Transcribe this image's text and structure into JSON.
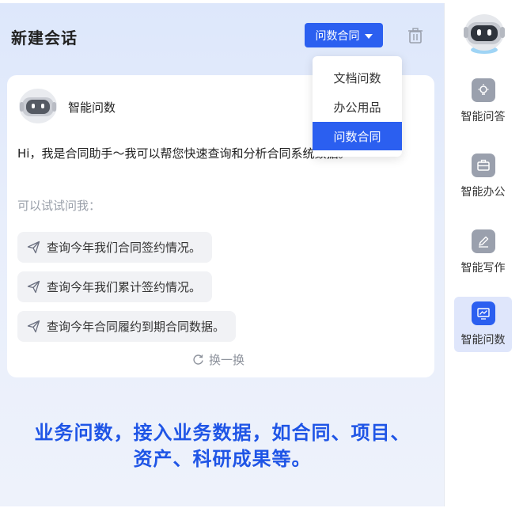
{
  "header": {
    "title": "新建会话",
    "mode_select": "问数合同",
    "trash_icon": "trash-icon"
  },
  "dropdown": {
    "items": [
      "文档问数",
      "办公用品",
      "问数合同"
    ],
    "active_index": 2
  },
  "card": {
    "bot_name": "智能问数",
    "intro": "Hi，我是合同助手～我可以帮您快速查询和分析合同系统数据。",
    "try_label": "可以试试问我：",
    "suggestions": [
      "查询今年我们合同签约情况。",
      "查询今年我们累计签约情况。",
      "查询今年合同履约到期合同数据。"
    ],
    "refresh_label": "换一换"
  },
  "banner": {
    "line1": "业务问数，接入业务数据，如合同、项目、",
    "line2": "资产、科研成果等。"
  },
  "sidebar": {
    "items": [
      {
        "label": "智能问答",
        "icon": "lightbulb-icon"
      },
      {
        "label": "智能办公",
        "icon": "briefcase-icon"
      },
      {
        "label": "智能写作",
        "icon": "pen-icon"
      },
      {
        "label": "智能问数",
        "icon": "chart-icon"
      }
    ],
    "active_index": 3
  },
  "colors": {
    "accent": "#2b5ff0",
    "banner": "#1f55e6"
  }
}
